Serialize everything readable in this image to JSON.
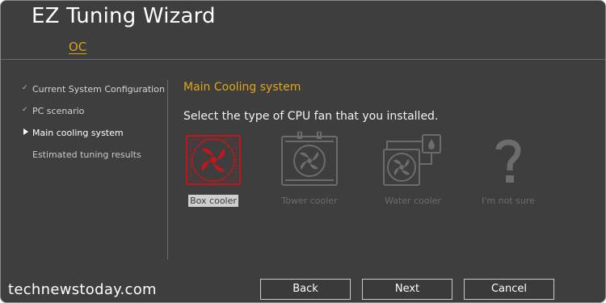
{
  "window": {
    "title": "EZ Tuning Wizard"
  },
  "tabs": [
    {
      "label": "OC"
    }
  ],
  "steps": [
    {
      "label": "Current System Configuration",
      "state": "done"
    },
    {
      "label": "PC scenario",
      "state": "done"
    },
    {
      "label": "Main cooling system",
      "state": "active"
    },
    {
      "label": "Estimated tuning results",
      "state": "pending"
    }
  ],
  "main": {
    "section_title": "Main Cooling system",
    "instruction": "Select the type of CPU fan that you installed.",
    "options": [
      {
        "label": "Box cooler",
        "icon": "box-cooler-icon",
        "selected": true
      },
      {
        "label": "Tower cooler",
        "icon": "tower-cooler-icon",
        "selected": false
      },
      {
        "label": "Water cooler",
        "icon": "water-cooler-icon",
        "selected": false
      },
      {
        "label": "I'm not sure",
        "icon": "question-mark-icon",
        "selected": false
      }
    ]
  },
  "buttons": {
    "back": "Back",
    "next": "Next",
    "cancel": "Cancel"
  },
  "watermark": "technewstoday.com",
  "colors": {
    "accent": "#e2a618",
    "selected_icon": "#c0161c",
    "background": "#3e3e3e",
    "dim_icon": "#6c6c6c"
  }
}
